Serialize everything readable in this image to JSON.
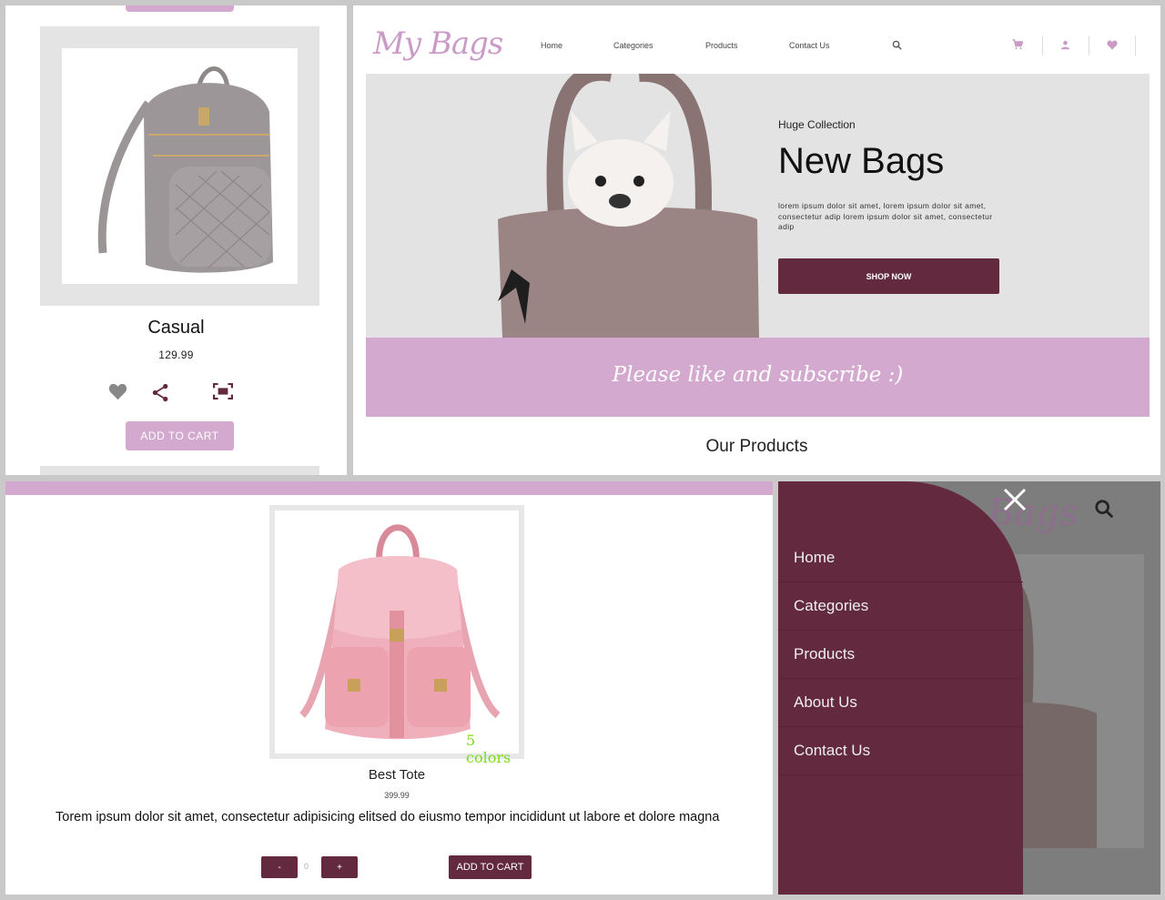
{
  "card": {
    "name": "Casual",
    "price": "129.99",
    "add_to_cart_label": "ADD TO CART",
    "icons": [
      "heart-icon",
      "share-icon",
      "fullscreen-icon"
    ]
  },
  "desktop": {
    "logo": "My Bags",
    "nav": [
      "Home",
      "Categories",
      "Products",
      "Contact Us"
    ],
    "nav_icons": [
      "search-icon",
      "cart-icon",
      "user-icon",
      "heart-icon"
    ],
    "hero": {
      "kicker": "Huge Collection",
      "title": "New Bags",
      "text": "lorem ipsum dolor sit amet, lorem ipsum dolor sit amet, consectetur adip lorem ipsum dolor sit amet, consectetur adip",
      "button": "SHOP NOW"
    },
    "banner": "Please like and subscribe :)",
    "section_title": "Our Products"
  },
  "detail": {
    "image_overlay": "5 colors",
    "name": "Best Tote",
    "price": "399.99",
    "description": "Torem ipsum dolor sit amet, consectetur adipisicing elitsed do eiusmo tempor incididunt ut labore et dolore magna",
    "minus": "-",
    "quantity": "0",
    "plus": "+",
    "add_to_cart_label": "ADD TO CART"
  },
  "mobile": {
    "background_logo": "Bags",
    "menu": [
      "Home",
      "Categories",
      "Products",
      "About Us",
      "Contact Us"
    ]
  },
  "colors": {
    "accent_pink": "#d3a9cf",
    "accent_maroon": "#632a3f",
    "logo_pink": "#c99bc6"
  }
}
